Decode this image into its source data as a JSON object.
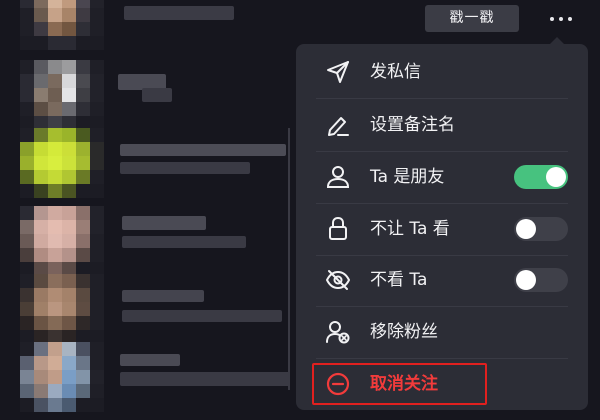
{
  "header": {
    "poke_label": "戳一戳",
    "more_icon": "more-dots-icon"
  },
  "menu": {
    "items": [
      {
        "label": "发私信",
        "icon": "paper-plane-icon"
      },
      {
        "label": "设置备注名",
        "icon": "edit-pen-icon"
      },
      {
        "label": "Ta 是朋友",
        "icon": "user-icon",
        "toggle": true,
        "checked": true
      },
      {
        "label": "不让 Ta 看",
        "icon": "lock-icon",
        "toggle": true,
        "checked": false
      },
      {
        "label": "不看 Ta",
        "icon": "eye-off-icon",
        "toggle": true,
        "checked": false
      },
      {
        "label": "移除粉丝",
        "icon": "remove-user-icon"
      },
      {
        "label": "取消关注",
        "icon": "minus-circle-icon",
        "highlighted": true
      }
    ]
  },
  "colors": {
    "toggle_on": "#47c27f",
    "toggle_off": "#3f4049",
    "danger": "#f23b3b",
    "highlight_border": "#e1201f",
    "menu_bg": "#2c2d36",
    "page_bg": "#16161e"
  }
}
